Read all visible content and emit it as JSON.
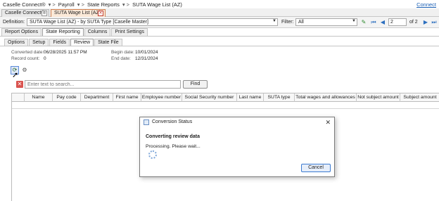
{
  "breadcrumb": {
    "items": [
      "Caselle Connect®",
      "Payroll",
      "State Reports",
      "SUTA Wage List (AZ)"
    ],
    "separator": "▾ >",
    "right_link": "Connect"
  },
  "doc_tabs": [
    {
      "label": "Caselle Connect®",
      "close": "⊗"
    },
    {
      "label": "SUTA Wage List (AZ)",
      "close": "✕"
    }
  ],
  "definition": {
    "label": "Definition:",
    "value": "SUTA Wage List (AZ) - by SUTA Type [Caselle Master]",
    "filter_label": "Filter:",
    "filter_value": "All",
    "page_value": "2",
    "page_of": "of 2"
  },
  "main_tabs": [
    "Report Options",
    "State Reporting",
    "Columns",
    "Print Settings"
  ],
  "sub_tabs": [
    "Options",
    "Setup",
    "Fields",
    "Review",
    "State File"
  ],
  "info": {
    "converted_label": "Converted date:",
    "converted_value": "06/28/2025 11:57 PM",
    "record_label": "Record count:",
    "record_value": "0",
    "begin_label": "Begin date:",
    "begin_value": "10/01/2024",
    "end_label": "End date:",
    "end_value": "12/31/2024"
  },
  "search": {
    "placeholder": "Enter text to search...",
    "find_label": "Find"
  },
  "grid_columns": [
    "Name",
    "Pay code",
    "Department",
    "First name",
    "Employee number",
    "Social Security number",
    "Last name",
    "SUTA type",
    "Total wages and allowances",
    "Not subject amount",
    "Subject amount"
  ],
  "dialog": {
    "title": "Conversion Status",
    "heading": "Converting review data",
    "message": "Processing. Please wait...",
    "cancel_label": "Cancel",
    "close_label": "✕"
  },
  "colors": {
    "accent": "#3b7ad0",
    "tab_highlight": "#fbe9d8",
    "clear_button": "#d9534f"
  }
}
